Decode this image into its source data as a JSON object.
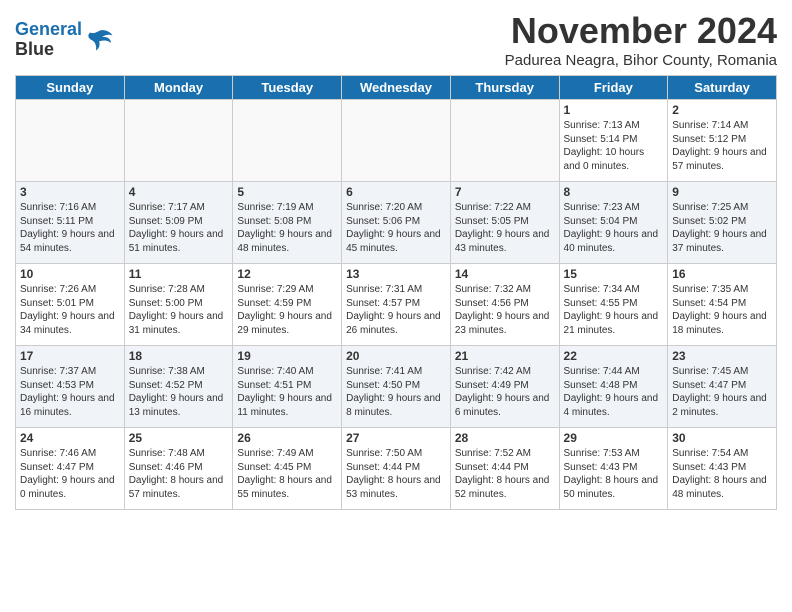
{
  "header": {
    "logo_line1": "General",
    "logo_line2": "Blue",
    "month_title": "November 2024",
    "subtitle": "Padurea Neagra, Bihor County, Romania"
  },
  "weekdays": [
    "Sunday",
    "Monday",
    "Tuesday",
    "Wednesday",
    "Thursday",
    "Friday",
    "Saturday"
  ],
  "weeks": [
    [
      {
        "day": "",
        "info": ""
      },
      {
        "day": "",
        "info": ""
      },
      {
        "day": "",
        "info": ""
      },
      {
        "day": "",
        "info": ""
      },
      {
        "day": "",
        "info": ""
      },
      {
        "day": "1",
        "info": "Sunrise: 7:13 AM\nSunset: 5:14 PM\nDaylight: 10 hours and 0 minutes."
      },
      {
        "day": "2",
        "info": "Sunrise: 7:14 AM\nSunset: 5:12 PM\nDaylight: 9 hours and 57 minutes."
      }
    ],
    [
      {
        "day": "3",
        "info": "Sunrise: 7:16 AM\nSunset: 5:11 PM\nDaylight: 9 hours and 54 minutes."
      },
      {
        "day": "4",
        "info": "Sunrise: 7:17 AM\nSunset: 5:09 PM\nDaylight: 9 hours and 51 minutes."
      },
      {
        "day": "5",
        "info": "Sunrise: 7:19 AM\nSunset: 5:08 PM\nDaylight: 9 hours and 48 minutes."
      },
      {
        "day": "6",
        "info": "Sunrise: 7:20 AM\nSunset: 5:06 PM\nDaylight: 9 hours and 45 minutes."
      },
      {
        "day": "7",
        "info": "Sunrise: 7:22 AM\nSunset: 5:05 PM\nDaylight: 9 hours and 43 minutes."
      },
      {
        "day": "8",
        "info": "Sunrise: 7:23 AM\nSunset: 5:04 PM\nDaylight: 9 hours and 40 minutes."
      },
      {
        "day": "9",
        "info": "Sunrise: 7:25 AM\nSunset: 5:02 PM\nDaylight: 9 hours and 37 minutes."
      }
    ],
    [
      {
        "day": "10",
        "info": "Sunrise: 7:26 AM\nSunset: 5:01 PM\nDaylight: 9 hours and 34 minutes."
      },
      {
        "day": "11",
        "info": "Sunrise: 7:28 AM\nSunset: 5:00 PM\nDaylight: 9 hours and 31 minutes."
      },
      {
        "day": "12",
        "info": "Sunrise: 7:29 AM\nSunset: 4:59 PM\nDaylight: 9 hours and 29 minutes."
      },
      {
        "day": "13",
        "info": "Sunrise: 7:31 AM\nSunset: 4:57 PM\nDaylight: 9 hours and 26 minutes."
      },
      {
        "day": "14",
        "info": "Sunrise: 7:32 AM\nSunset: 4:56 PM\nDaylight: 9 hours and 23 minutes."
      },
      {
        "day": "15",
        "info": "Sunrise: 7:34 AM\nSunset: 4:55 PM\nDaylight: 9 hours and 21 minutes."
      },
      {
        "day": "16",
        "info": "Sunrise: 7:35 AM\nSunset: 4:54 PM\nDaylight: 9 hours and 18 minutes."
      }
    ],
    [
      {
        "day": "17",
        "info": "Sunrise: 7:37 AM\nSunset: 4:53 PM\nDaylight: 9 hours and 16 minutes."
      },
      {
        "day": "18",
        "info": "Sunrise: 7:38 AM\nSunset: 4:52 PM\nDaylight: 9 hours and 13 minutes."
      },
      {
        "day": "19",
        "info": "Sunrise: 7:40 AM\nSunset: 4:51 PM\nDaylight: 9 hours and 11 minutes."
      },
      {
        "day": "20",
        "info": "Sunrise: 7:41 AM\nSunset: 4:50 PM\nDaylight: 9 hours and 8 minutes."
      },
      {
        "day": "21",
        "info": "Sunrise: 7:42 AM\nSunset: 4:49 PM\nDaylight: 9 hours and 6 minutes."
      },
      {
        "day": "22",
        "info": "Sunrise: 7:44 AM\nSunset: 4:48 PM\nDaylight: 9 hours and 4 minutes."
      },
      {
        "day": "23",
        "info": "Sunrise: 7:45 AM\nSunset: 4:47 PM\nDaylight: 9 hours and 2 minutes."
      }
    ],
    [
      {
        "day": "24",
        "info": "Sunrise: 7:46 AM\nSunset: 4:47 PM\nDaylight: 9 hours and 0 minutes."
      },
      {
        "day": "25",
        "info": "Sunrise: 7:48 AM\nSunset: 4:46 PM\nDaylight: 8 hours and 57 minutes."
      },
      {
        "day": "26",
        "info": "Sunrise: 7:49 AM\nSunset: 4:45 PM\nDaylight: 8 hours and 55 minutes."
      },
      {
        "day": "27",
        "info": "Sunrise: 7:50 AM\nSunset: 4:44 PM\nDaylight: 8 hours and 53 minutes."
      },
      {
        "day": "28",
        "info": "Sunrise: 7:52 AM\nSunset: 4:44 PM\nDaylight: 8 hours and 52 minutes."
      },
      {
        "day": "29",
        "info": "Sunrise: 7:53 AM\nSunset: 4:43 PM\nDaylight: 8 hours and 50 minutes."
      },
      {
        "day": "30",
        "info": "Sunrise: 7:54 AM\nSunset: 4:43 PM\nDaylight: 8 hours and 48 minutes."
      }
    ]
  ]
}
